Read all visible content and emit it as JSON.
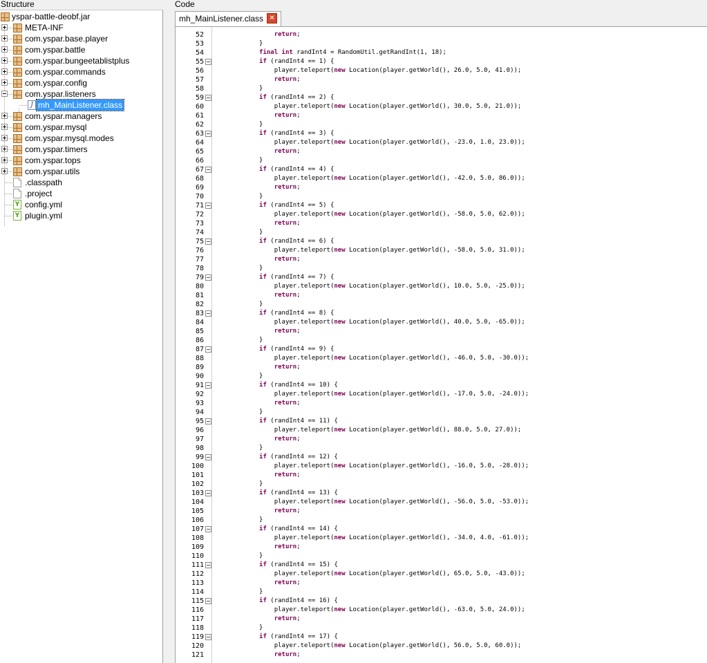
{
  "structure": {
    "title": "Structure",
    "root": "yspar-battle-deobf.jar",
    "items": [
      {
        "label": "META-INF",
        "type": "package",
        "expandable": true
      },
      {
        "label": "com.yspar.base.player",
        "type": "package",
        "expandable": true
      },
      {
        "label": "com.yspar.battle",
        "type": "package",
        "expandable": true
      },
      {
        "label": "com.yspar.bungeetablistplus",
        "type": "package",
        "expandable": true
      },
      {
        "label": "com.yspar.commands",
        "type": "package",
        "expandable": true
      },
      {
        "label": "com.yspar.config",
        "type": "package",
        "expandable": true
      },
      {
        "label": "com.yspar.listeners",
        "type": "package",
        "expandable": true,
        "expanded": true
      },
      {
        "label": "mh_MainListener.class",
        "type": "class",
        "child": true,
        "selected": true
      },
      {
        "label": "com.yspar.managers",
        "type": "package",
        "expandable": true
      },
      {
        "label": "com.yspar.mysql",
        "type": "package",
        "expandable": true
      },
      {
        "label": "com.yspar.mysql.modes",
        "type": "package",
        "expandable": true
      },
      {
        "label": "com.yspar.timers",
        "type": "package",
        "expandable": true
      },
      {
        "label": "com.yspar.tops",
        "type": "package",
        "expandable": true
      },
      {
        "label": "com.yspar.utils",
        "type": "package",
        "expandable": true
      },
      {
        "label": ".classpath",
        "type": "file"
      },
      {
        "label": ".project",
        "type": "file"
      },
      {
        "label": "config.yml",
        "type": "yml"
      },
      {
        "label": "plugin.yml",
        "type": "yml"
      }
    ]
  },
  "code": {
    "title": "Code",
    "tab": {
      "label": "mh_MainListener.class",
      "close_icon": "close-icon"
    },
    "colors": {
      "keyword": "#7f0055",
      "selection": "#3399ff"
    },
    "lines": [
      {
        "n": "52",
        "fold": false,
        "indent": "                ",
        "text": "return;"
      },
      {
        "n": "53",
        "fold": false,
        "indent": "            ",
        "text": "}"
      },
      {
        "n": "54",
        "fold": false,
        "indent": "            ",
        "text": "final int randInt4 = RandomUtil.getRandInt(1, 18);"
      },
      {
        "n": "55",
        "fold": true,
        "indent": "            ",
        "text": "if (randInt4 == 1) {"
      },
      {
        "n": "56",
        "fold": false,
        "indent": "                ",
        "text": "player.teleport(new Location(player.getWorld(), 26.0, 5.0, 41.0));"
      },
      {
        "n": "57",
        "fold": false,
        "indent": "                ",
        "text": "return;"
      },
      {
        "n": "58",
        "fold": false,
        "indent": "            ",
        "text": "}"
      },
      {
        "n": "59",
        "fold": true,
        "indent": "            ",
        "text": "if (randInt4 == 2) {"
      },
      {
        "n": "60",
        "fold": false,
        "indent": "                ",
        "text": "player.teleport(new Location(player.getWorld(), 30.0, 5.0, 21.0));"
      },
      {
        "n": "61",
        "fold": false,
        "indent": "                ",
        "text": "return;"
      },
      {
        "n": "62",
        "fold": false,
        "indent": "            ",
        "text": "}"
      },
      {
        "n": "63",
        "fold": true,
        "indent": "            ",
        "text": "if (randInt4 == 3) {"
      },
      {
        "n": "64",
        "fold": false,
        "indent": "                ",
        "text": "player.teleport(new Location(player.getWorld(), -23.0, 1.0, 23.0));"
      },
      {
        "n": "65",
        "fold": false,
        "indent": "                ",
        "text": "return;"
      },
      {
        "n": "66",
        "fold": false,
        "indent": "            ",
        "text": "}"
      },
      {
        "n": "67",
        "fold": true,
        "indent": "            ",
        "text": "if (randInt4 == 4) {"
      },
      {
        "n": "68",
        "fold": false,
        "indent": "                ",
        "text": "player.teleport(new Location(player.getWorld(), -42.0, 5.0, 86.0));"
      },
      {
        "n": "69",
        "fold": false,
        "indent": "                ",
        "text": "return;"
      },
      {
        "n": "70",
        "fold": false,
        "indent": "            ",
        "text": "}"
      },
      {
        "n": "71",
        "fold": true,
        "indent": "            ",
        "text": "if (randInt4 == 5) {"
      },
      {
        "n": "72",
        "fold": false,
        "indent": "                ",
        "text": "player.teleport(new Location(player.getWorld(), -58.0, 5.0, 62.0));"
      },
      {
        "n": "73",
        "fold": false,
        "indent": "                ",
        "text": "return;"
      },
      {
        "n": "74",
        "fold": false,
        "indent": "            ",
        "text": "}"
      },
      {
        "n": "75",
        "fold": true,
        "indent": "            ",
        "text": "if (randInt4 == 6) {"
      },
      {
        "n": "76",
        "fold": false,
        "indent": "                ",
        "text": "player.teleport(new Location(player.getWorld(), -58.0, 5.0, 31.0));"
      },
      {
        "n": "77",
        "fold": false,
        "indent": "                ",
        "text": "return;"
      },
      {
        "n": "78",
        "fold": false,
        "indent": "            ",
        "text": "}"
      },
      {
        "n": "79",
        "fold": true,
        "indent": "            ",
        "text": "if (randInt4 == 7) {"
      },
      {
        "n": "80",
        "fold": false,
        "indent": "                ",
        "text": "player.teleport(new Location(player.getWorld(), 10.0, 5.0, -25.0));"
      },
      {
        "n": "81",
        "fold": false,
        "indent": "                ",
        "text": "return;"
      },
      {
        "n": "82",
        "fold": false,
        "indent": "            ",
        "text": "}"
      },
      {
        "n": "83",
        "fold": true,
        "indent": "            ",
        "text": "if (randInt4 == 8) {"
      },
      {
        "n": "84",
        "fold": false,
        "indent": "                ",
        "text": "player.teleport(new Location(player.getWorld(), 40.0, 5.0, -65.0));"
      },
      {
        "n": "85",
        "fold": false,
        "indent": "                ",
        "text": "return;"
      },
      {
        "n": "86",
        "fold": false,
        "indent": "            ",
        "text": "}"
      },
      {
        "n": "87",
        "fold": true,
        "indent": "            ",
        "text": "if (randInt4 == 9) {"
      },
      {
        "n": "88",
        "fold": false,
        "indent": "                ",
        "text": "player.teleport(new Location(player.getWorld(), -46.0, 5.0, -30.0));"
      },
      {
        "n": "89",
        "fold": false,
        "indent": "                ",
        "text": "return;"
      },
      {
        "n": "90",
        "fold": false,
        "indent": "            ",
        "text": "}"
      },
      {
        "n": "91",
        "fold": true,
        "indent": "            ",
        "text": "if (randInt4 == 10) {"
      },
      {
        "n": "92",
        "fold": false,
        "indent": "                ",
        "text": "player.teleport(new Location(player.getWorld(), -17.0, 5.0, -24.0));"
      },
      {
        "n": "93",
        "fold": false,
        "indent": "                ",
        "text": "return;"
      },
      {
        "n": "94",
        "fold": false,
        "indent": "            ",
        "text": "}"
      },
      {
        "n": "95",
        "fold": true,
        "indent": "            ",
        "text": "if (randInt4 == 11) {"
      },
      {
        "n": "96",
        "fold": false,
        "indent": "                ",
        "text": "player.teleport(new Location(player.getWorld(), 88.0, 5.0, 27.0));"
      },
      {
        "n": "97",
        "fold": false,
        "indent": "                ",
        "text": "return;"
      },
      {
        "n": "98",
        "fold": false,
        "indent": "            ",
        "text": "}"
      },
      {
        "n": "99",
        "fold": true,
        "indent": "            ",
        "text": "if (randInt4 == 12) {"
      },
      {
        "n": "100",
        "fold": false,
        "indent": "                ",
        "text": "player.teleport(new Location(player.getWorld(), -16.0, 5.0, -28.0));"
      },
      {
        "n": "101",
        "fold": false,
        "indent": "                ",
        "text": "return;"
      },
      {
        "n": "102",
        "fold": false,
        "indent": "            ",
        "text": "}"
      },
      {
        "n": "103",
        "fold": true,
        "indent": "            ",
        "text": "if (randInt4 == 13) {"
      },
      {
        "n": "104",
        "fold": false,
        "indent": "                ",
        "text": "player.teleport(new Location(player.getWorld(), -56.0, 5.0, -53.0));"
      },
      {
        "n": "105",
        "fold": false,
        "indent": "                ",
        "text": "return;"
      },
      {
        "n": "106",
        "fold": false,
        "indent": "            ",
        "text": "}"
      },
      {
        "n": "107",
        "fold": true,
        "indent": "            ",
        "text": "if (randInt4 == 14) {"
      },
      {
        "n": "108",
        "fold": false,
        "indent": "                ",
        "text": "player.teleport(new Location(player.getWorld(), -34.0, 4.0, -61.0));"
      },
      {
        "n": "109",
        "fold": false,
        "indent": "                ",
        "text": "return;"
      },
      {
        "n": "110",
        "fold": false,
        "indent": "            ",
        "text": "}"
      },
      {
        "n": "111",
        "fold": true,
        "indent": "            ",
        "text": "if (randInt4 == 15) {"
      },
      {
        "n": "112",
        "fold": false,
        "indent": "                ",
        "text": "player.teleport(new Location(player.getWorld(), 65.0, 5.0, -43.0));"
      },
      {
        "n": "113",
        "fold": false,
        "indent": "                ",
        "text": "return;"
      },
      {
        "n": "114",
        "fold": false,
        "indent": "            ",
        "text": "}"
      },
      {
        "n": "115",
        "fold": true,
        "indent": "            ",
        "text": "if (randInt4 == 16) {"
      },
      {
        "n": "116",
        "fold": false,
        "indent": "                ",
        "text": "player.teleport(new Location(player.getWorld(), -63.0, 5.0, 24.0));"
      },
      {
        "n": "117",
        "fold": false,
        "indent": "                ",
        "text": "return;"
      },
      {
        "n": "118",
        "fold": false,
        "indent": "            ",
        "text": "}"
      },
      {
        "n": "119",
        "fold": true,
        "indent": "            ",
        "text": "if (randInt4 == 17) {"
      },
      {
        "n": "120",
        "fold": false,
        "indent": "                ",
        "text": "player.teleport(new Location(player.getWorld(), 56.0, 5.0, 60.0));"
      },
      {
        "n": "121",
        "fold": false,
        "indent": "                ",
        "text": "return;"
      }
    ]
  }
}
